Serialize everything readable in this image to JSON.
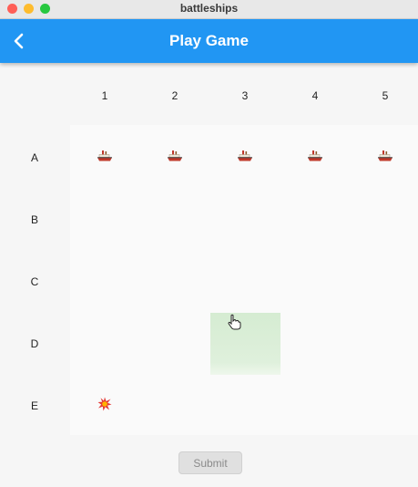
{
  "window": {
    "title": "battleships"
  },
  "appbar": {
    "title": "Play Game",
    "back_icon": "chevron-left-icon"
  },
  "grid": {
    "columns": [
      "1",
      "2",
      "3",
      "4",
      "5"
    ],
    "rows": [
      "A",
      "B",
      "C",
      "D",
      "E"
    ],
    "ship_icon": "ship-icon",
    "hit_icon": "explosion-icon",
    "selected_cell": "D3",
    "ships": [
      "A1",
      "A2",
      "A3",
      "A4",
      "A5"
    ],
    "hits": [
      "E1"
    ]
  },
  "submit": {
    "label": "Submit"
  },
  "colors": {
    "appbar": "#2196f3",
    "selected_cell": "#d8eed6",
    "ship_hull": "#c0392b",
    "ship_deck": "#efe6d8"
  }
}
